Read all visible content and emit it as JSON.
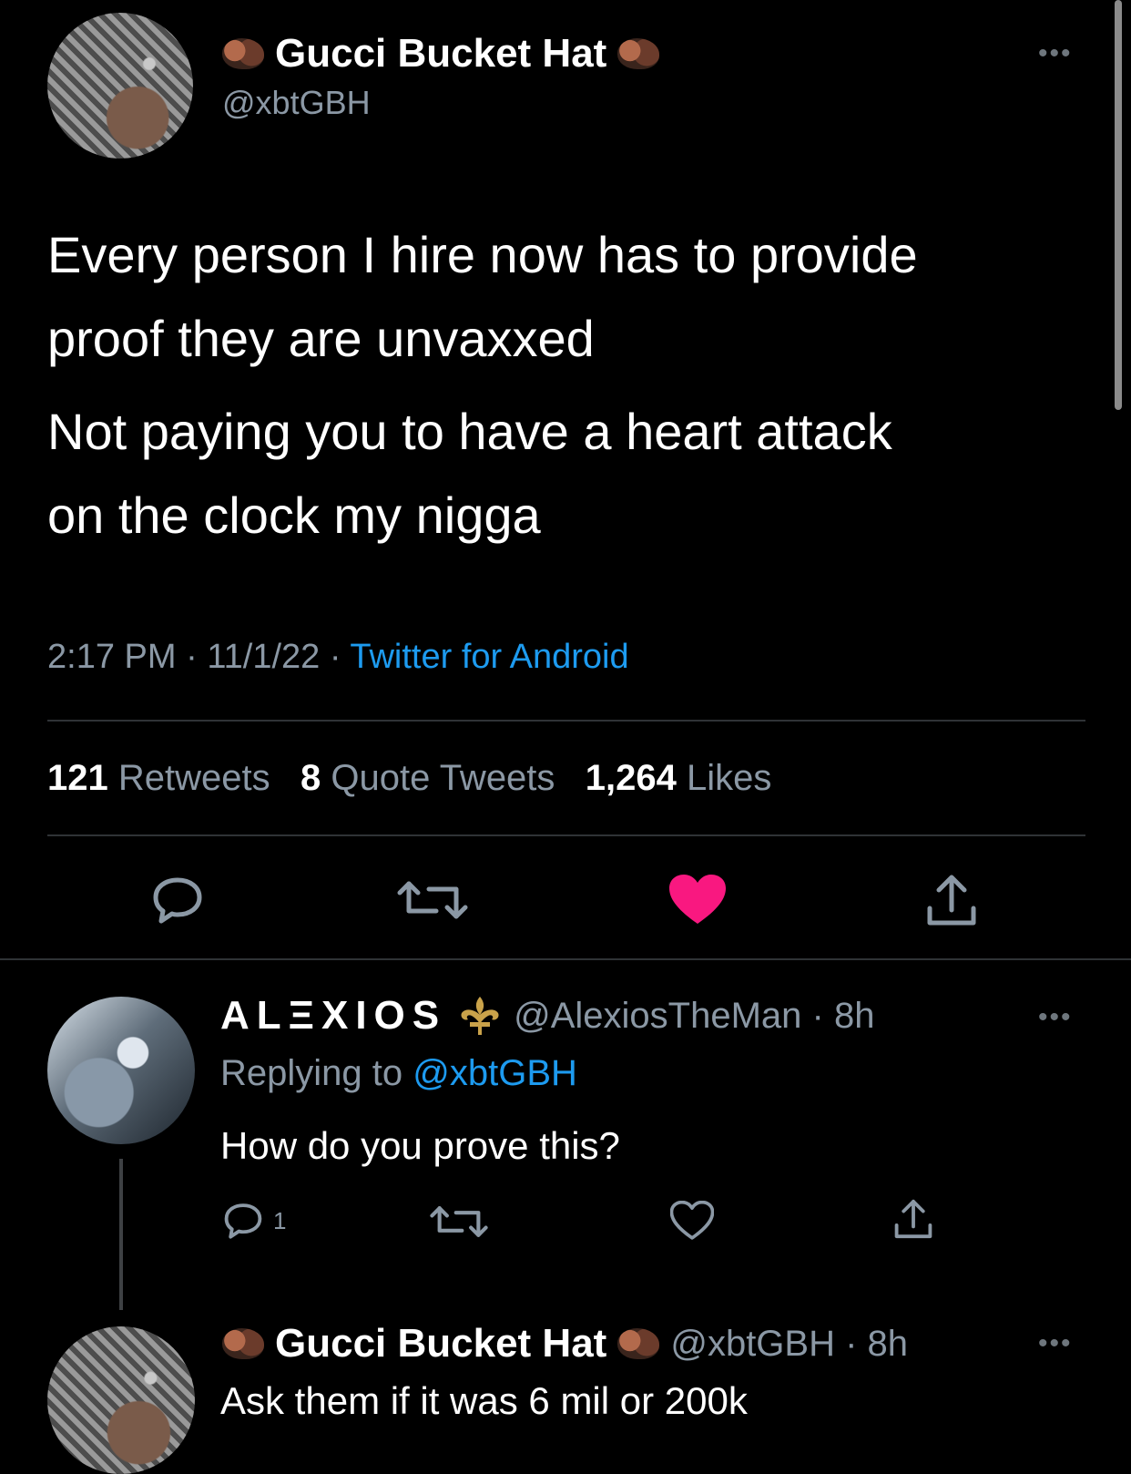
{
  "tweet": {
    "display_name": "Gucci Bucket Hat",
    "handle": "@xbtGBH",
    "text_line1": "Every person I hire now has to provide",
    "text_line2": "proof they are unvaxxed",
    "text_line3": "Not paying you to have a heart attack",
    "text_line4": "on the clock my nigga",
    "time": "2:17 PM",
    "date": "11/1/22",
    "source": "Twitter for Android",
    "retweets_count": "121",
    "retweets_label": "Retweets",
    "quotes_count": "8",
    "quotes_label": "Quote Tweets",
    "likes_count": "1,264",
    "likes_label": "Likes",
    "liked": true,
    "accent": "#1d9bf0",
    "like_color": "#f91880"
  },
  "reply1": {
    "display_name": "ALΞXIOS",
    "handle_time": "@AlexiosTheMan · 8h",
    "replying_prefix": "Replying to",
    "replying_handle": "@xbtGBH",
    "text": "How do you prove this?",
    "reply_count": "1"
  },
  "reply2": {
    "display_name": "Gucci Bucket Hat",
    "handle_time": "@xbtGBH · 8h",
    "text": "Ask them if it was 6 mil or 200k"
  },
  "icons": {
    "more": "more-dots-icon",
    "reply": "reply-icon",
    "retweet": "retweet-icon",
    "like": "heart-icon",
    "share": "share-icon",
    "name_emoji": "turkey-emoji-icon",
    "fleur": "fleur-de-lis-icon"
  }
}
